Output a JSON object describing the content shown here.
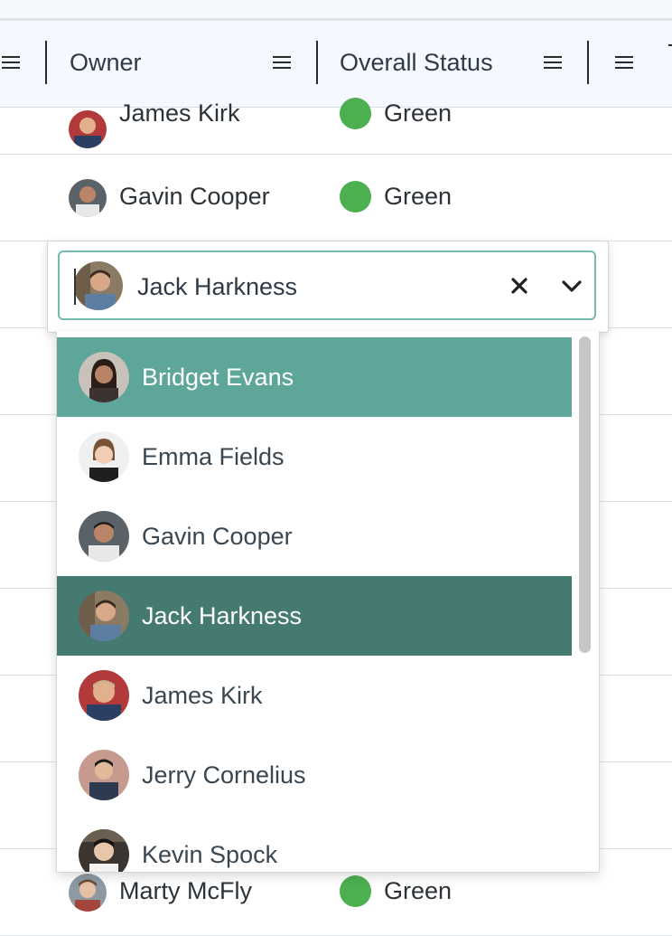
{
  "grid": {
    "columns": [
      {
        "label": "Owner"
      },
      {
        "label": "Overall Status"
      }
    ],
    "rows": [
      {
        "owner": "James Kirk",
        "status": "Green"
      },
      {
        "owner": "Gavin Cooper",
        "status": "Green"
      },
      {
        "owner": "",
        "status": ""
      },
      {
        "owner": "Marty McFly",
        "status": "Green"
      }
    ]
  },
  "editor": {
    "value": "Jack Harkness"
  },
  "dropdown": {
    "options": [
      {
        "label": "Bridget Evans",
        "state": "hover"
      },
      {
        "label": "Emma Fields",
        "state": "normal"
      },
      {
        "label": "Gavin Cooper",
        "state": "normal"
      },
      {
        "label": "Jack Harkness",
        "state": "selected"
      },
      {
        "label": "James Kirk",
        "state": "normal"
      },
      {
        "label": "Jerry Cornelius",
        "state": "normal"
      },
      {
        "label": "Kevin Spock",
        "state": "normal"
      }
    ]
  },
  "colors": {
    "status_green": "#4caf50",
    "option_hover": "#5ea69a",
    "option_selected": "#447a70",
    "focus_border": "#74b9ad"
  },
  "icons": {
    "column_menu": "menu-icon",
    "clear": "close-icon",
    "expand": "chevron-down-icon",
    "status": "status-dot-icon"
  }
}
